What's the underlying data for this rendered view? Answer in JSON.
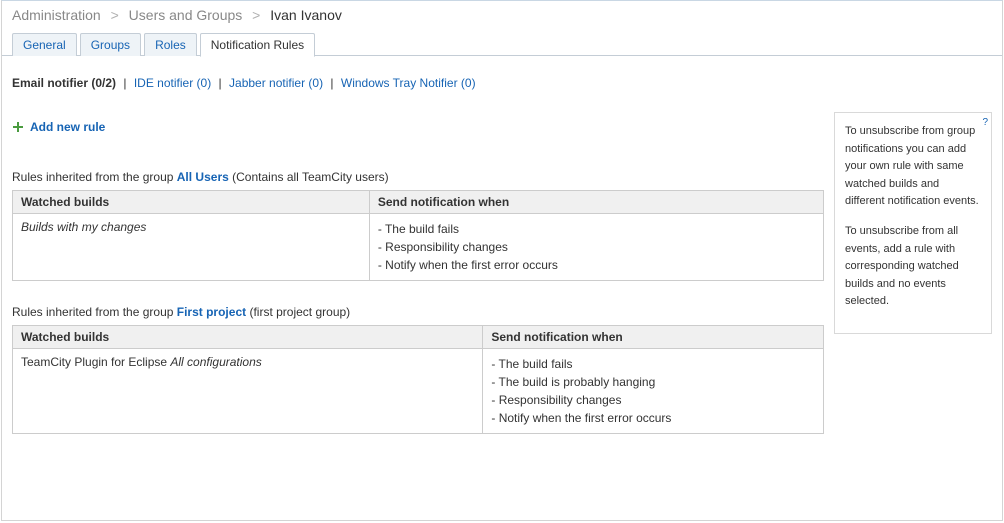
{
  "breadcrumb": {
    "admin": "Administration",
    "users_groups": "Users and Groups",
    "current": "Ivan Ivanov"
  },
  "tabs": {
    "general": "General",
    "groups": "Groups",
    "roles": "Roles",
    "notification_rules": "Notification Rules"
  },
  "notifiers": {
    "email": "Email notifier (0/2)",
    "ide": "IDE notifier (0)",
    "jabber": "Jabber notifier (0)",
    "tray": "Windows Tray Notifier (0)"
  },
  "add_rule_label": "Add new rule",
  "table_headers": {
    "watched": "Watched builds",
    "when": "Send notification when"
  },
  "groups": [
    {
      "prefix": "Rules inherited from the group ",
      "name": "All Users",
      "suffix": " (Contains all TeamCity users)",
      "rows": [
        {
          "watched_text": "Builds with my changes",
          "watched_italic_all": true,
          "conditions": [
            "- The build fails",
            "- Responsibility changes",
            "- Notify when the first error occurs"
          ]
        }
      ]
    },
    {
      "prefix": "Rules inherited from the group ",
      "name": "First project",
      "suffix": " (first project group)",
      "rows": [
        {
          "watched_prefix": "TeamCity Plugin for Eclipse ",
          "watched_italic": "All configurations",
          "conditions": [
            "- The build fails",
            "- The build is probably hanging",
            "- Responsibility changes",
            "- Notify when the first error occurs"
          ]
        }
      ]
    }
  ],
  "sidebar": {
    "help_glyph": "?",
    "p1": "To unsubscribe from group notifications you can add your own rule with same watched builds and different notification events.",
    "p2": "To unsubscribe from all events, add a rule with corresponding watched builds and no events selected."
  }
}
